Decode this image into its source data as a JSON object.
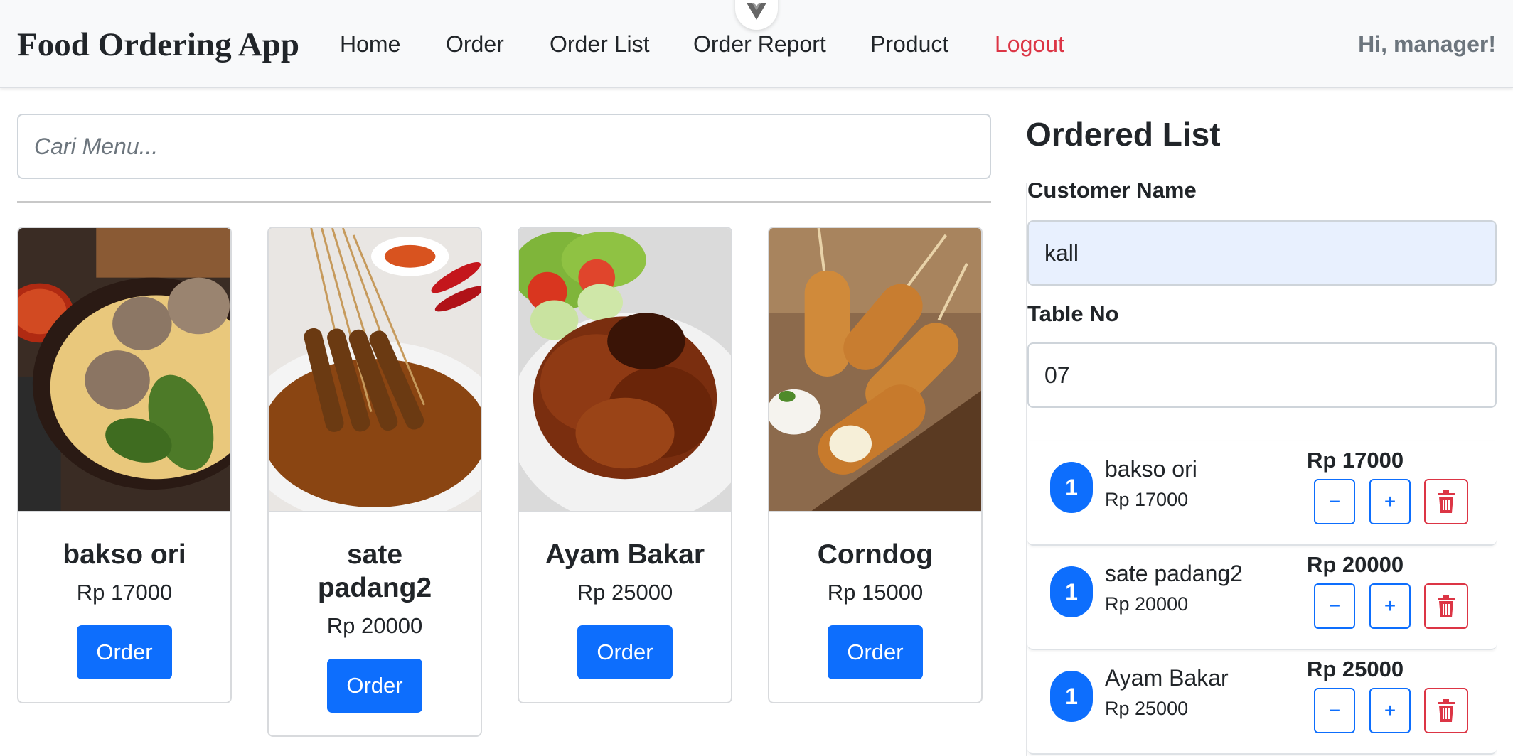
{
  "navbar": {
    "brand": "Food Ordering App",
    "links": [
      "Home",
      "Order",
      "Order List",
      "Order Report",
      "Product"
    ],
    "logout": "Logout",
    "greeting": "Hi, manager!"
  },
  "search": {
    "placeholder": "Cari Menu..."
  },
  "menu": [
    {
      "name": "bakso ori",
      "price": "Rp 17000",
      "button": "Order"
    },
    {
      "name": "sate padang2",
      "price": "Rp 20000",
      "button": "Order"
    },
    {
      "name": "Ayam Bakar",
      "price": "Rp 25000",
      "button": "Order"
    },
    {
      "name": "Corndog",
      "price": "Rp 15000",
      "button": "Order"
    }
  ],
  "ordered": {
    "title": "Ordered List",
    "customer_label": "Customer Name",
    "customer_value": "kall",
    "table_label": "Table No",
    "table_value": "07",
    "items": [
      {
        "qty": "1",
        "name": "bakso ori",
        "unit_price": "Rp 17000",
        "total": "Rp 17000",
        "minus": "−",
        "plus": "+"
      },
      {
        "qty": "1",
        "name": "sate padang2",
        "unit_price": "Rp 20000",
        "total": "Rp 20000",
        "minus": "−",
        "plus": "+"
      },
      {
        "qty": "1",
        "name": "Ayam Bakar",
        "unit_price": "Rp 25000",
        "total": "Rp 25000",
        "minus": "−",
        "plus": "+"
      }
    ]
  },
  "colors": {
    "primary": "#0d6efd",
    "danger": "#dc3545",
    "muted": "#6c757d",
    "navbar_bg": "#f8f9fa",
    "autofill_bg": "#e8f0fe"
  },
  "icons": {
    "devtools": "vue-chevron-icon",
    "delete": "trash-icon"
  }
}
